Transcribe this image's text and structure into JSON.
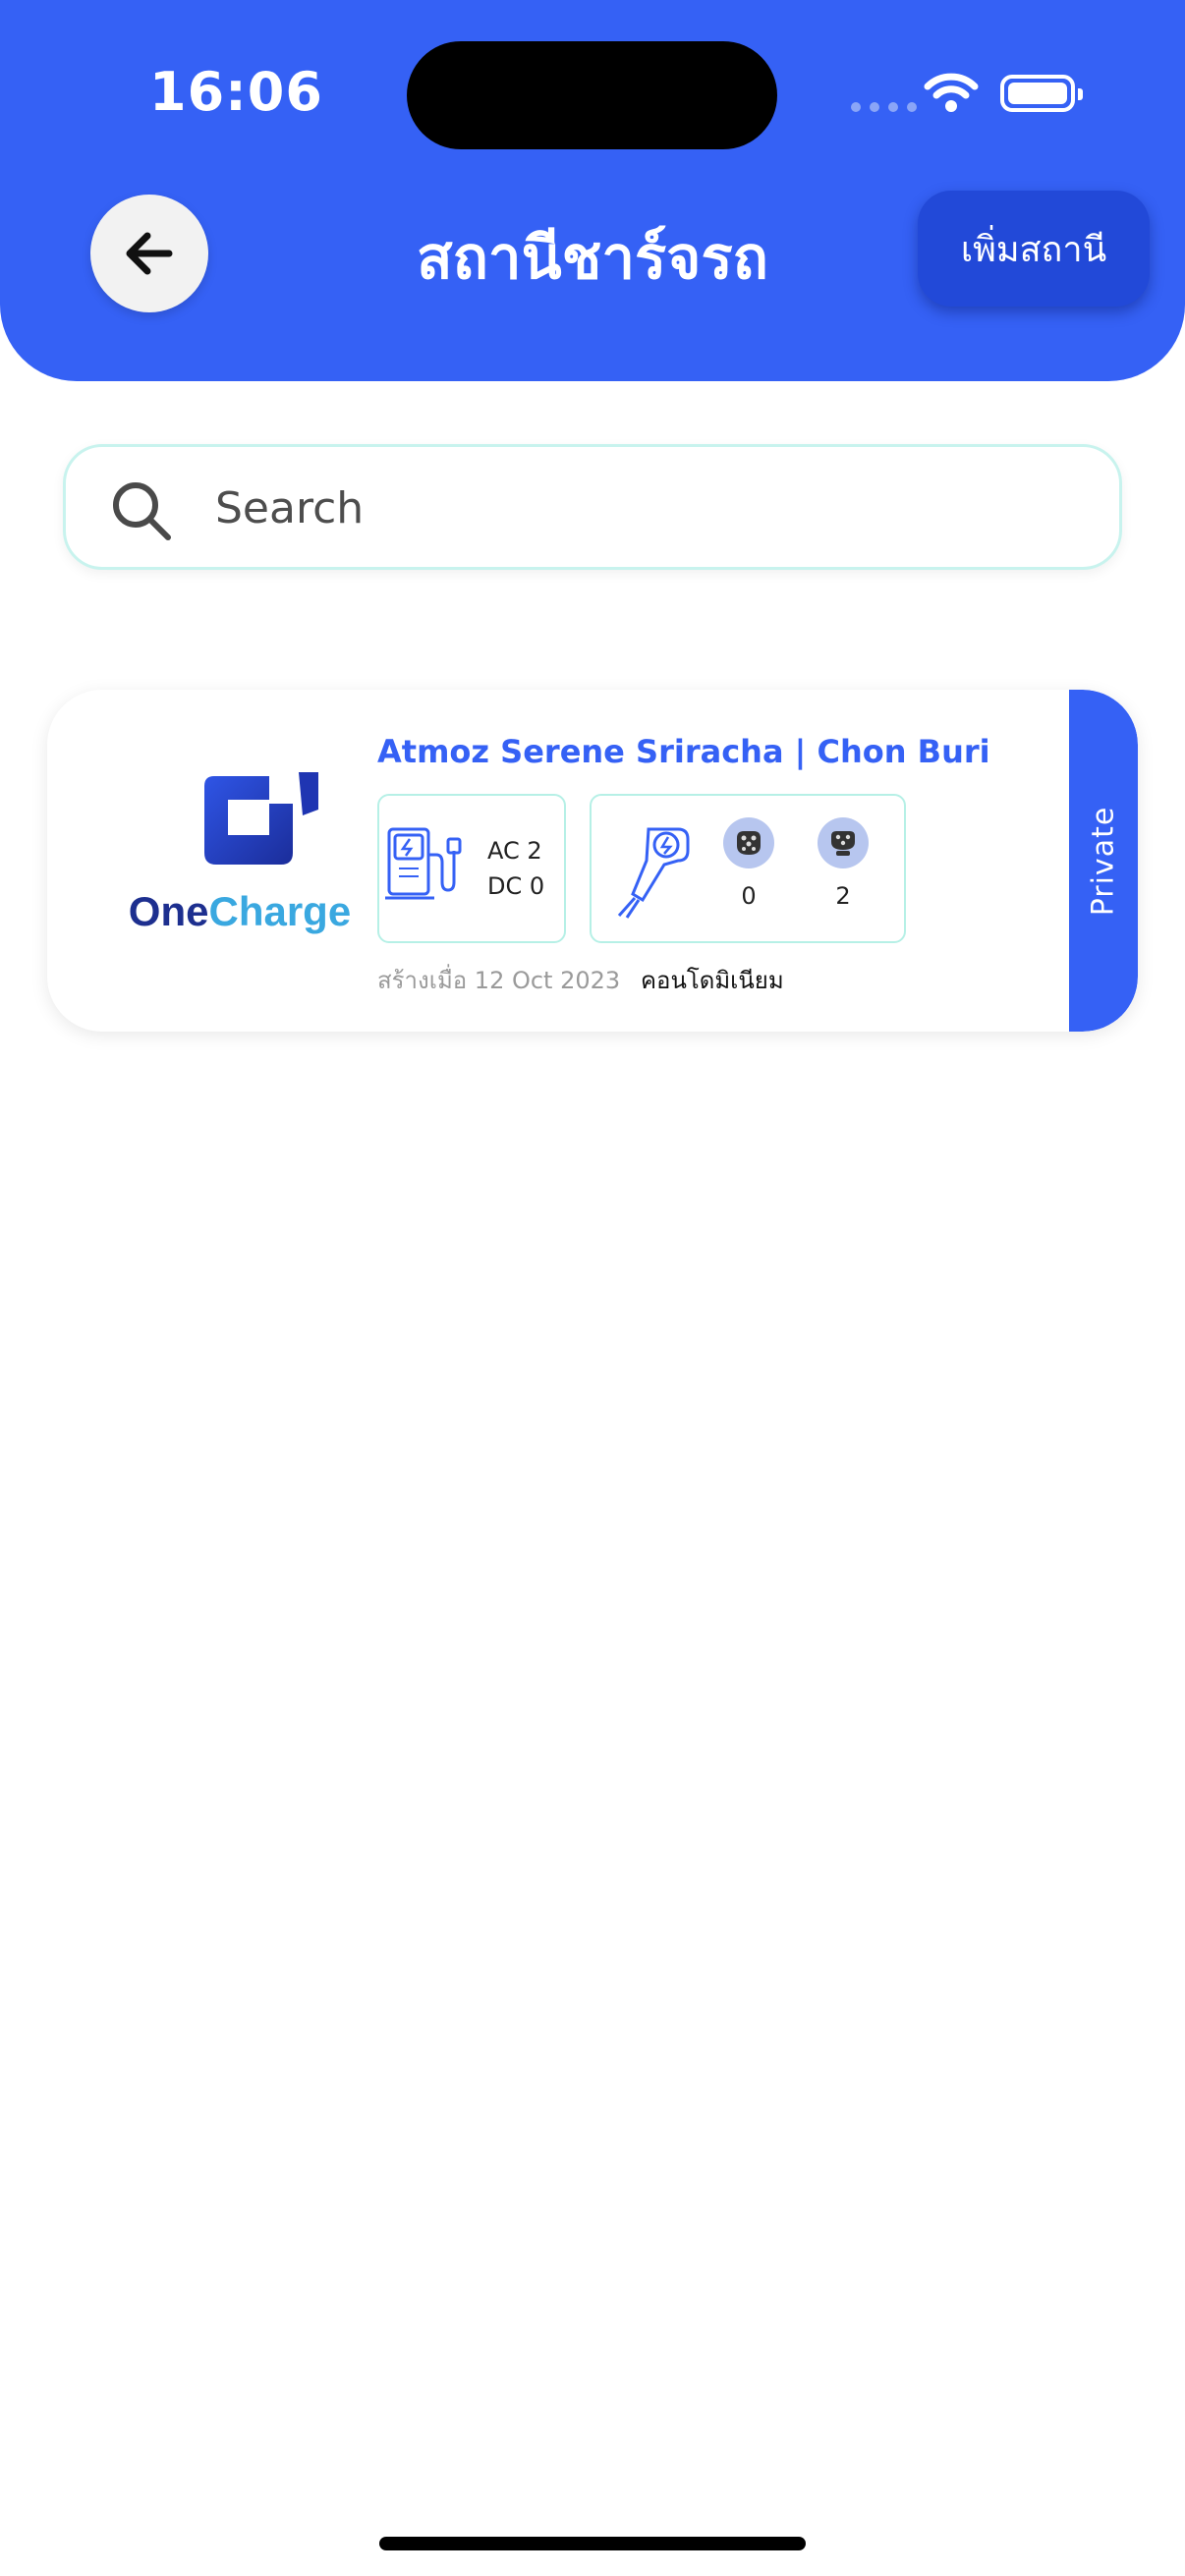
{
  "status_bar": {
    "time": "16:06"
  },
  "header": {
    "title": "สถานีชาร์จรถ",
    "add_button_label": "เพิ่มสถานี",
    "bg_color": "#3561F5"
  },
  "search": {
    "placeholder": "Search"
  },
  "stations": [
    {
      "logo": {
        "text_one": "One",
        "text_charge": "Charge"
      },
      "name": "Atmoz Serene Sriracha | Chon Buri",
      "ac_text": "AC 2",
      "dc_text": "DC 0",
      "connectors": [
        {
          "icon": "type2-connector-icon",
          "count": "0"
        },
        {
          "icon": "ccs2-connector-icon",
          "count": "2"
        }
      ],
      "created": "สร้างเมื่อ 12 Oct 2023",
      "type": "คอนโดมิเนียม",
      "visibility": "Private"
    }
  ]
}
